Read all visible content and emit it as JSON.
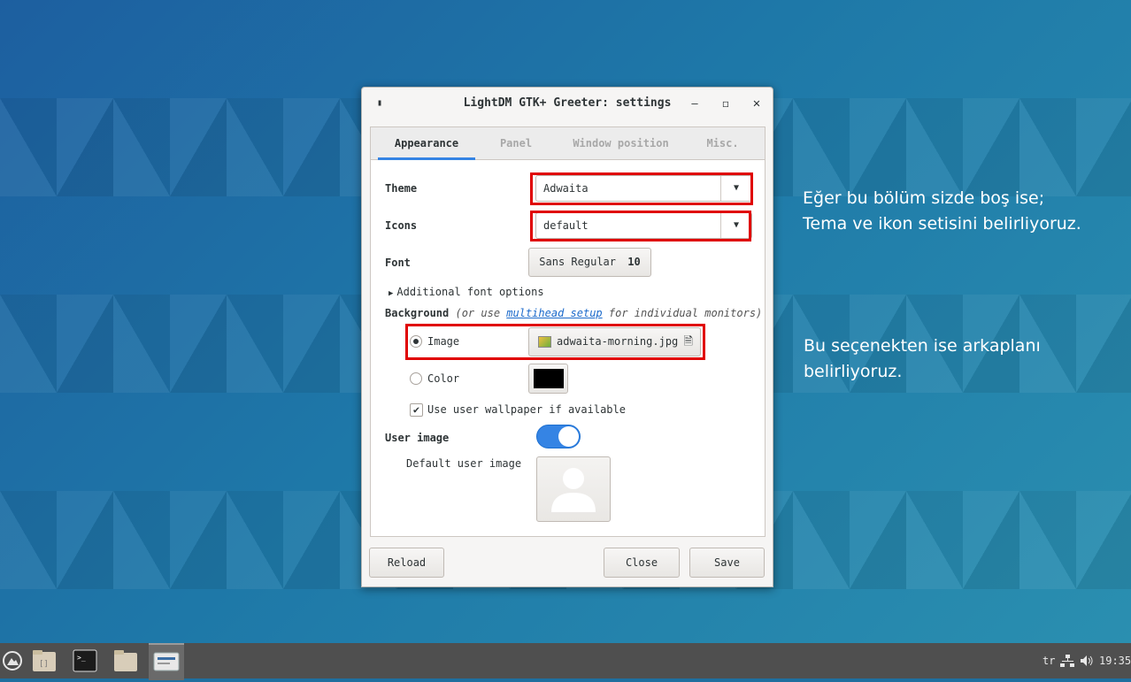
{
  "window": {
    "title": "LightDM GTK+ Greeter: settings",
    "icon": "app-icon",
    "min_icon": "–",
    "max_icon": "◻",
    "close_icon": "✕"
  },
  "tabs": [
    {
      "label": "Appearance",
      "active": true
    },
    {
      "label": "Panel",
      "active": false
    },
    {
      "label": "Window position",
      "active": false
    },
    {
      "label": "Misc.",
      "active": false
    }
  ],
  "appearance": {
    "theme_label": "Theme",
    "theme_value": "Adwaita",
    "icons_label": "Icons",
    "icons_value": "default",
    "font_label": "Font",
    "font_name": "Sans Regular",
    "font_size": "10",
    "additional_font_options": "Additional font options",
    "background_label": "Background",
    "background_hint_prefix": "(or use ",
    "background_hint_link": "multihead setup",
    "background_hint_suffix": " for individual monitors)",
    "image_label": "Image",
    "image_file": "adwaita-morning.jpg",
    "image_selected": true,
    "color_label": "Color",
    "color_value": "#000000",
    "use_wallpaper_label": "Use user wallpaper if available",
    "use_wallpaper_checked": true,
    "user_image_label": "User image",
    "user_image_enabled": true,
    "default_user_image_label": "Default user image"
  },
  "buttons": {
    "reload": "Reload",
    "close": "Close",
    "save": "Save"
  },
  "annotations": {
    "first_line1": "Eğer bu bölüm sizde boş ise;",
    "first_line2": "Tema ve ikon setisini belirliyoruz.",
    "second_line1": "Bu seçenekten ise arkaplanı",
    "second_line2": "belirliyoruz."
  },
  "taskbar": {
    "items": [
      "menu-icon",
      "file-manager-icon",
      "terminal-icon",
      "folder-icon",
      "settings-window-icon"
    ],
    "keyboard_layout": "tr",
    "network_icon": "network-icon",
    "volume_icon": "volume-icon",
    "clock": "19:35"
  },
  "colors": {
    "accent": "#3584e4",
    "highlight_box": "#e00000",
    "taskbar": "#4f4f4f"
  }
}
